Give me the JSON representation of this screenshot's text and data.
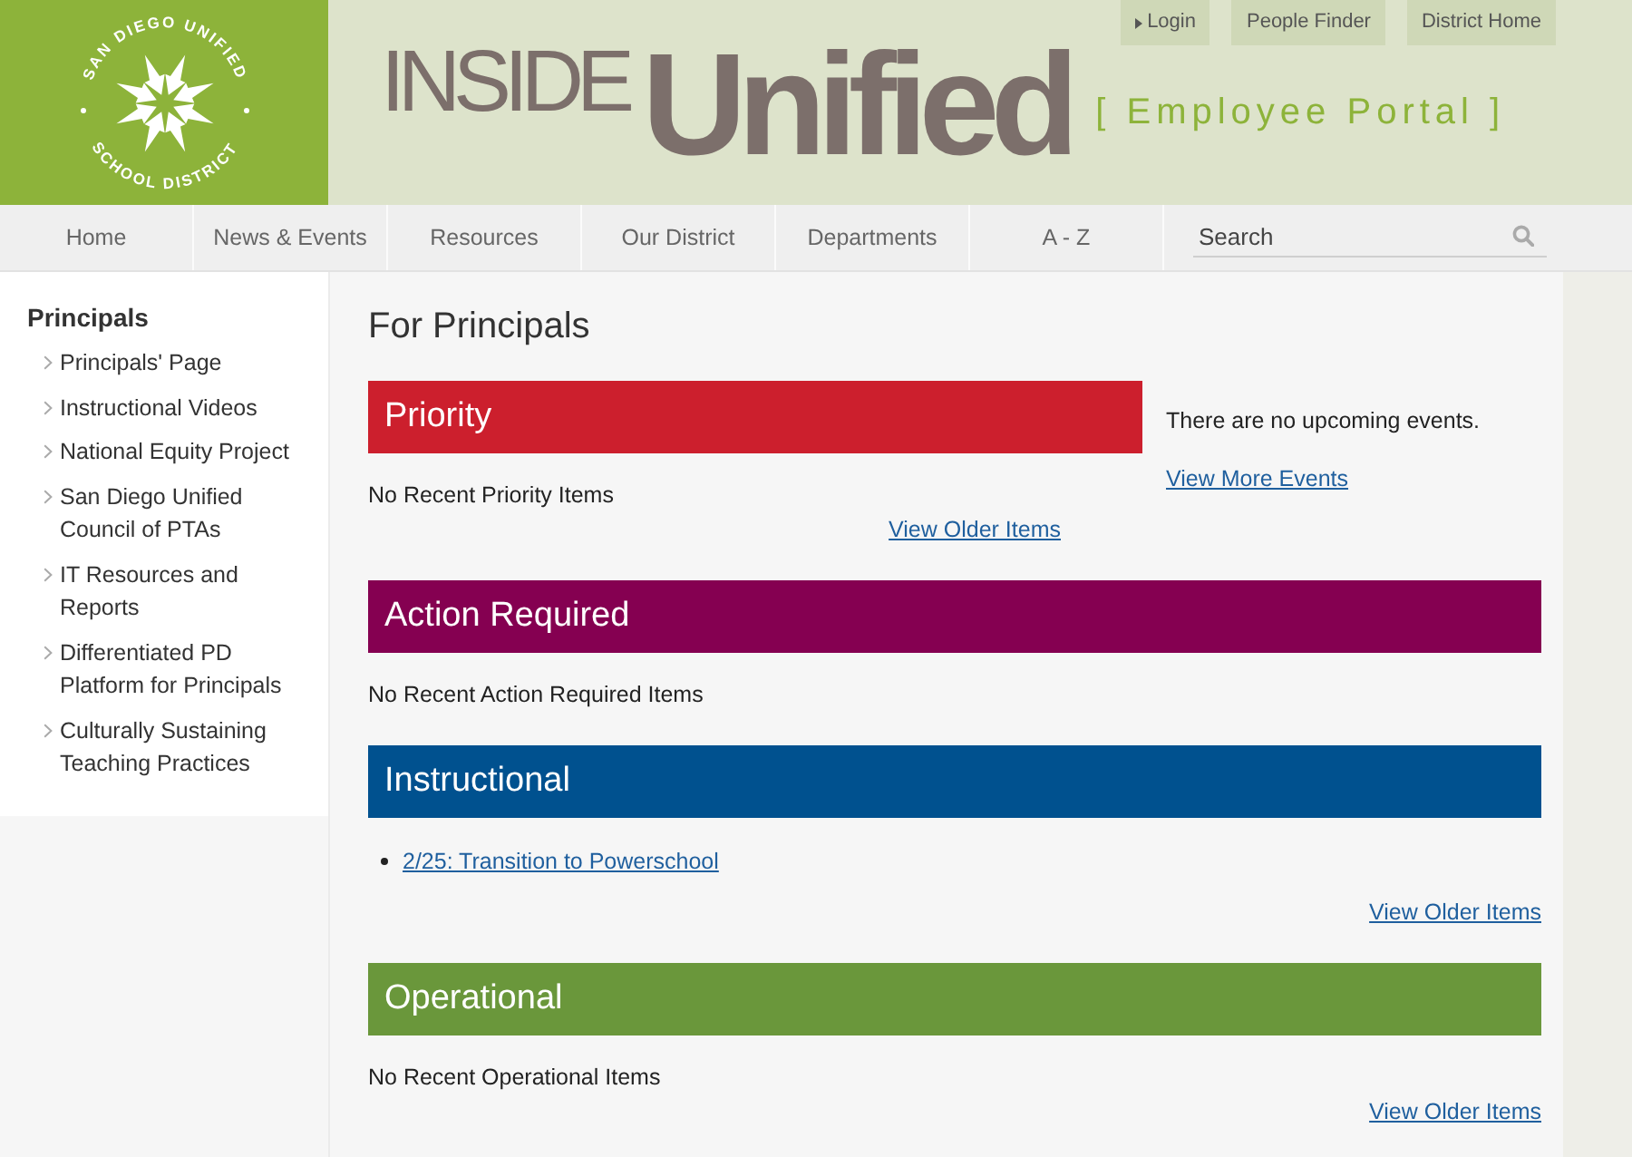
{
  "logo": {
    "top_text": "SAN DIEGO UNIFIED",
    "bottom_text": "SCHOOL DISTRICT"
  },
  "site_title": {
    "prefix": "INSIDE",
    "name": "Unified",
    "tagline": "[ Employee Portal ]"
  },
  "utility_links": [
    {
      "label": "Login",
      "kind": "login"
    },
    {
      "label": "People Finder",
      "kind": "link"
    },
    {
      "label": "District Home",
      "kind": "link"
    }
  ],
  "nav": {
    "items": [
      "Home",
      "News & Events",
      "Resources",
      "Our District",
      "Departments",
      "A - Z"
    ]
  },
  "search": {
    "placeholder": "Search"
  },
  "sidebar": {
    "title": "Principals",
    "items": [
      "Principals' Page",
      "Instructional Videos",
      "National Equity Project",
      "San Diego Unified Council of PTAs",
      "IT Resources and Reports",
      "Differentiated PD Platform for Principals",
      "Culturally Sustaining Teaching Practices"
    ]
  },
  "page_title": "For Principals",
  "sections": [
    {
      "title": "Priority",
      "color": "#cc1f2d",
      "message": "No Recent Priority Items",
      "more_link": "View Older Items"
    },
    {
      "title": "Action Required",
      "color": "#850051",
      "message": "No Recent Action Required Items"
    },
    {
      "title": "Instructional",
      "color": "#00518f",
      "items": [
        "2/25: Transition to Powerschool"
      ],
      "more_link": "View Older Items"
    },
    {
      "title": "Operational",
      "color": "#6a973b",
      "message": "No Recent Operational Items",
      "more_link": "View Older Items"
    }
  ],
  "events": {
    "message": "There are no upcoming events.",
    "link": "View More Events"
  }
}
